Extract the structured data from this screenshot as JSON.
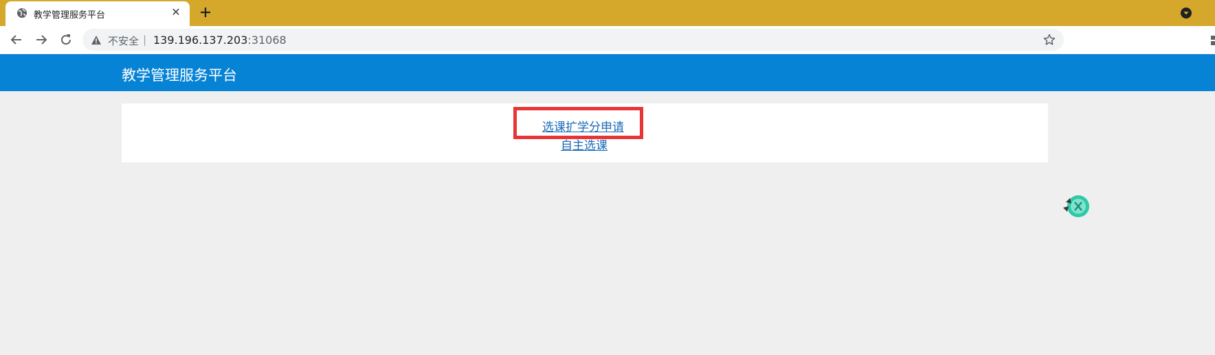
{
  "browser": {
    "tab_title": "教学管理服务平台",
    "tab_close": "✕",
    "address": {
      "insecure_label": "不安全",
      "separator": "|",
      "host": "139.196.137.203",
      "port": ":31068"
    }
  },
  "header": {
    "title": "教学管理服务平台"
  },
  "main": {
    "links": [
      {
        "label": "选课扩学分申请"
      },
      {
        "label": "自主选课"
      }
    ]
  },
  "colors": {
    "tabstrip": "#d5a82b",
    "header": "#0683d5",
    "link": "#1a6ab7",
    "highlight": "#e83434",
    "page_bg": "#efefef"
  }
}
